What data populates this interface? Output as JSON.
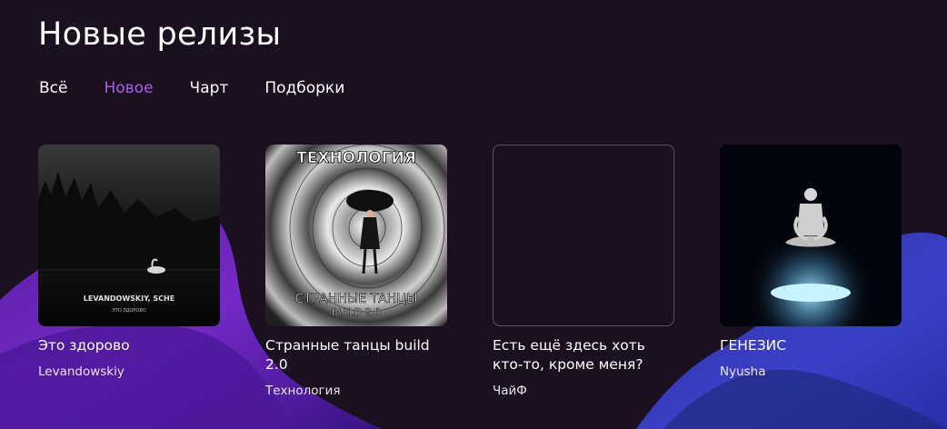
{
  "page": {
    "title": "Новые релизы"
  },
  "tabs": [
    {
      "label": "Всё",
      "active": false
    },
    {
      "label": "Новое",
      "active": true
    },
    {
      "label": "Чарт",
      "active": false
    },
    {
      "label": "Подборки",
      "active": false
    }
  ],
  "releases": [
    {
      "title": "Это здорово",
      "artist": "Levandowskiy",
      "cover_line1": "LEVANDOWSKIY, SCHE",
      "cover_line2": "ЭТО ЗДОРОВО"
    },
    {
      "title": "Странные танцы build 2.0",
      "artist": "Технология",
      "cover_top": "ТЕХНОЛОГИЯ",
      "cover_bottom1": "СТРАННЫЕ ТАНЦЫ",
      "cover_bottom2": "BUILD 2.0"
    },
    {
      "title": "Есть ещё здесь хоть кто-то, кроме меня?",
      "artist": "ЧайФ"
    },
    {
      "title": "ГЕНЕЗИС",
      "artist": "Nyusha"
    }
  ],
  "colors": {
    "background": "#1a1020",
    "active_tab": "#a85ce6",
    "wave_purple": "#7a2ad0",
    "wave_blue": "#3a40c8"
  }
}
